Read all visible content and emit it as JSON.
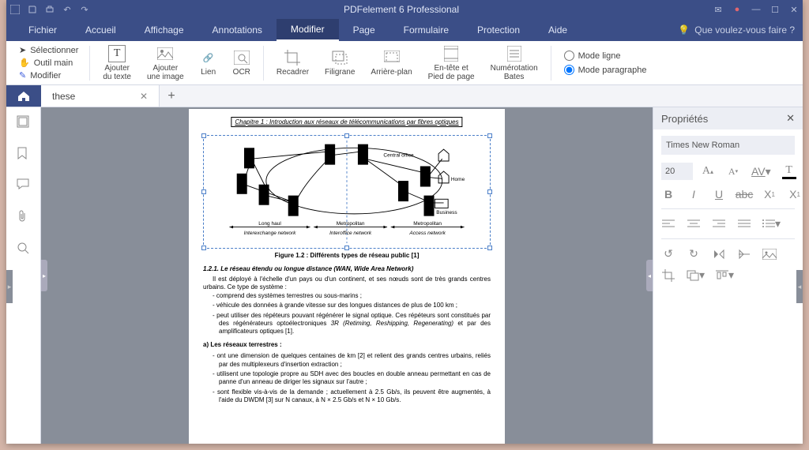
{
  "title": "PDFelement 6 Professional",
  "menu": [
    "Fichier",
    "Accueil",
    "Affichage",
    "Annotations",
    "Modifier",
    "Page",
    "Formulaire",
    "Protection",
    "Aide"
  ],
  "menuActive": 4,
  "help": "Que voulez-vous faire ?",
  "ribbon": {
    "left": {
      "select": "Sélectionner",
      "hand": "Outil main",
      "modify": "Modifier"
    },
    "addText": "Ajouter\ndu texte",
    "addImage": "Ajouter\nune image",
    "link": "Lien",
    "ocr": "OCR",
    "crop": "Recadrer",
    "watermark": "Filigrane",
    "background": "Arrière-plan",
    "headerFooter": "En-tête et\nPied de page",
    "bates": "Numérotation\nBates",
    "modeLine": "Mode ligne",
    "modePara": "Mode paragraphe"
  },
  "tab": {
    "name": "these"
  },
  "properties": {
    "title": "Propriétés",
    "font": "Times New Roman",
    "size": "20"
  },
  "doc": {
    "header": "Chapitre 1 : Introduction aux réseaux de télécommunications par fibres optiques",
    "diag": {
      "co": "Central office",
      "home": "Home",
      "business": "Business",
      "lh": "Long haul",
      "ie": "Interexchange network",
      "m1": "Metropolitan",
      "io": "Interoffice network",
      "m2": "Metropolitan",
      "an": "Access network"
    },
    "figcap": "Figure 1.2 : Différents types de réseau public [1]",
    "sec121": "1.2.1.   Le réseau étendu ou longue distance (WAN, Wide Area Network)",
    "p1": "Il est déployé à l'échelle d'un pays ou d'un continent, et ses nœuds sont de très grands centres urbains. Ce type de système :",
    "b1": "comprend des systèmes terrestres ou sous-marins ;",
    "b2": "véhicule des données à grande vitesse sur des longues distances de plus de 100 km ;",
    "b3": "peut utiliser des répéteurs pouvant régénérer le signal optique. Ces répéteurs sont constitués par des régénérateurs optoélectroniques ",
    "b3i": "3R (Retiming, Reshipping, Regenerating)",
    "b3e": " et par des amplificateurs optiques [1].",
    "sub_a": "a) Les réseaux terrestres :",
    "c1": "ont une dimension de quelques centaines de km [2] et relient des grands centres urbains, reliés par des multiplexeurs d'insertion extraction ;",
    "c2": "utilisent une topologie propre au SDH avec des boucles en double anneau permettant en cas de panne d'un anneau de diriger les signaux sur l'autre ;",
    "c3": "sont flexible vis-à-vis de la demande ; actuellement à 2.5 Gb/s, ils peuvent être augmentés, à l'aide du DWDM [3] sur N canaux, à N × 2.5 Gb/s et N × 10 Gb/s."
  }
}
